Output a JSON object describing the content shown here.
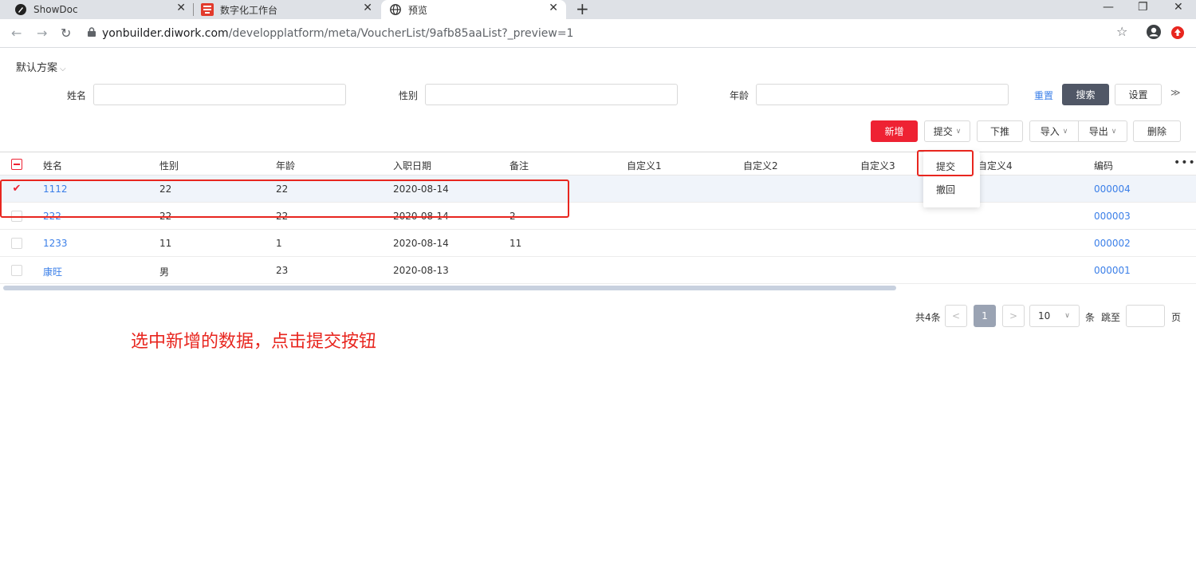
{
  "browser": {
    "tabs": [
      {
        "title": "ShowDoc",
        "icon": "showdoc-icon"
      },
      {
        "title": "数字化工作台",
        "icon": "yonyou-cloud-icon"
      },
      {
        "title": "预览",
        "icon": "globe-icon"
      }
    ],
    "url_host": "yonbuilder.diwork.com",
    "url_path": "/developplatform/meta/VoucherList/9afb85aaList?_preview=1"
  },
  "scheme": {
    "label": "默认方案",
    "caret": "⌵"
  },
  "filters": [
    {
      "label": "姓名",
      "value": ""
    },
    {
      "label": "性别",
      "value": ""
    },
    {
      "label": "年龄",
      "value": ""
    }
  ],
  "filter_actions": {
    "reset": "重置",
    "search": "搜索",
    "settings": "设置",
    "expand": "≫"
  },
  "toolbar": {
    "add": "新增",
    "submit": "提交",
    "push_down": "下推",
    "import": "导入",
    "export": "导出",
    "delete": "删除"
  },
  "submit_menu": [
    "提交",
    "撤回"
  ],
  "table": {
    "columns": [
      "姓名",
      "性别",
      "年龄",
      "入职日期",
      "备注",
      "自定义1",
      "自定义2",
      "自定义3",
      "自定义4",
      "编码"
    ],
    "rows": [
      {
        "name": "1112",
        "gender": "22",
        "age": "22",
        "date": "2020-08-14",
        "remark": "",
        "code": "000004",
        "checked": true
      },
      {
        "name": "222",
        "gender": "22",
        "age": "22",
        "date": "2020-08-14",
        "remark": "2",
        "code": "000003",
        "checked": false
      },
      {
        "name": "1233",
        "gender": "11",
        "age": "1",
        "date": "2020-08-14",
        "remark": "11",
        "code": "000002",
        "checked": false
      },
      {
        "name": "康旺",
        "gender": "男",
        "age": "23",
        "date": "2020-08-13",
        "remark": "",
        "code": "000001",
        "checked": false
      }
    ]
  },
  "pagination": {
    "total": "共4条",
    "current": "1",
    "page_size": "10",
    "unit": "条",
    "jump": "跳至",
    "page": "页"
  },
  "annotation": "选中新增的数据，点击提交按钮",
  "colors": {
    "primary_red": "#ee2233",
    "link_blue": "#3b7fe8",
    "annotation_red": "#e8261f",
    "search_btn": "#505766"
  }
}
